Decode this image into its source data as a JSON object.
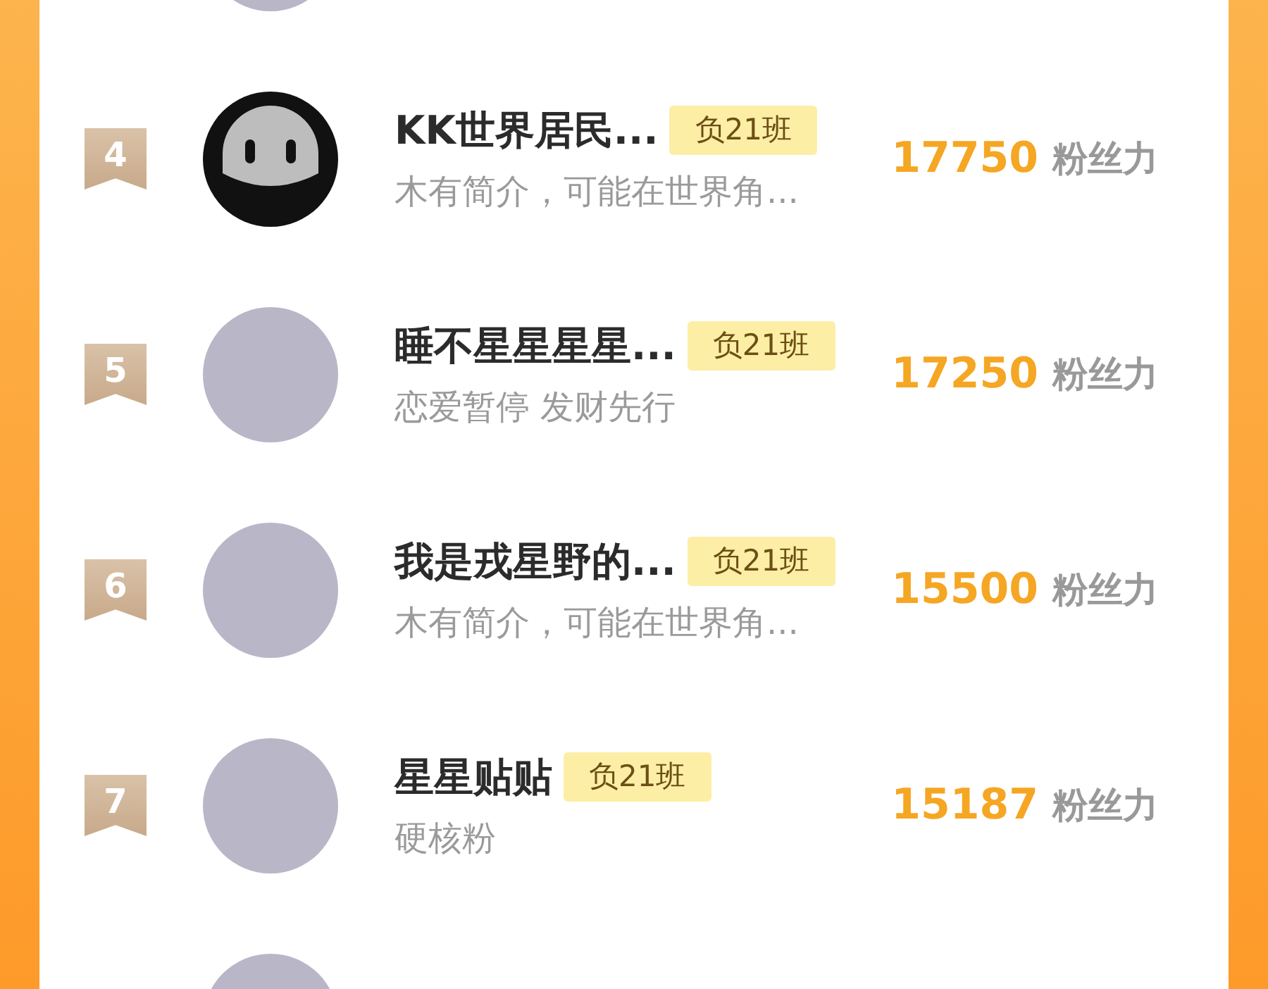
{
  "rows": [
    {
      "kind": "partial",
      "avatar": {
        "kind": "image"
      }
    },
    {
      "kind": "entry",
      "rank": "4",
      "avatar": {
        "kind": "face"
      },
      "name": "KK世界居民...",
      "tag": "负21班",
      "bio": "木有简介，可能在世界角...",
      "score": "17750",
      "unit": "粉丝力"
    },
    {
      "kind": "entry",
      "rank": "5",
      "avatar": {
        "kind": "image"
      },
      "name": "睡不星星星星...",
      "tag": "负21班",
      "bio": "恋爱暂停 发财先行",
      "score": "17250",
      "unit": "粉丝力"
    },
    {
      "kind": "entry",
      "rank": "6",
      "avatar": {
        "kind": "image"
      },
      "name": "我是戎星野的...",
      "tag": "负21班",
      "bio": "木有简介，可能在世界角...",
      "score": "15500",
      "unit": "粉丝力"
    },
    {
      "kind": "entry",
      "rank": "7",
      "avatar": {
        "kind": "image"
      },
      "name": "星星贴贴",
      "tag": "负21班",
      "bio": "硬核粉",
      "score": "15187",
      "unit": "粉丝力"
    },
    {
      "kind": "partial",
      "avatar": {
        "kind": "image"
      }
    }
  ]
}
